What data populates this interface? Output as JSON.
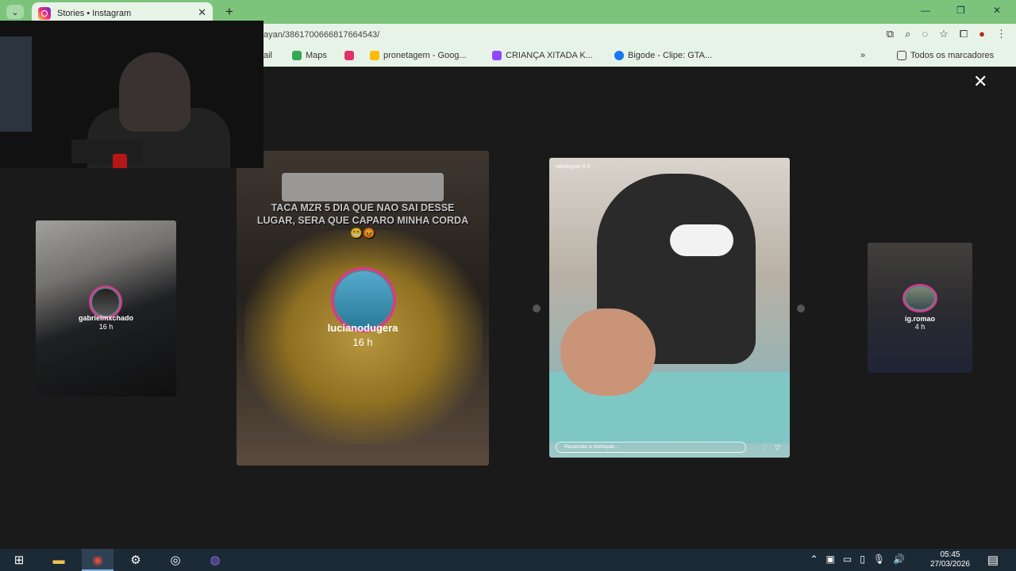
{
  "browser": {
    "tab_title": "Stories • Instagram",
    "tab_close": "✕",
    "new_tab": "+",
    "url": "ayan/3861700666817664543/",
    "bookmarks": [
      {
        "label": "ail",
        "color": "#ea4335"
      },
      {
        "label": "Maps",
        "color": "#34a853"
      },
      {
        "label": "",
        "color": "#e1306c"
      },
      {
        "label": "pronetagem - Goog...",
        "color": "#fbbc05"
      },
      {
        "label": "CRIANÇA XITADA K...",
        "color": "#9146ff"
      },
      {
        "label": "Bigode - Clipe: GTA...",
        "color": "#1877f2"
      }
    ],
    "bookmarks_more": "»",
    "all_bookmarks": "Todos os marcadores"
  },
  "viewer": {
    "close": "✕",
    "stories": [
      {
        "username": "gabrielmxchado",
        "time": "16 h"
      },
      {
        "username": "lucianodugera",
        "time": "16 h",
        "caption": "TACA MZR 5 DIA QUE NAO SAI DESSE LUGAR, SERA QUE CAPARO MINHA CORDA 😬😡"
      },
      {
        "username": "vitorkayan",
        "time": "8 h",
        "reply_placeholder": "Responder a vitorkayan..."
      },
      {
        "username": "ig.romao",
        "time": "4 h"
      }
    ]
  },
  "taskbar": {
    "time": "05:45",
    "date": "27/03/2026"
  }
}
